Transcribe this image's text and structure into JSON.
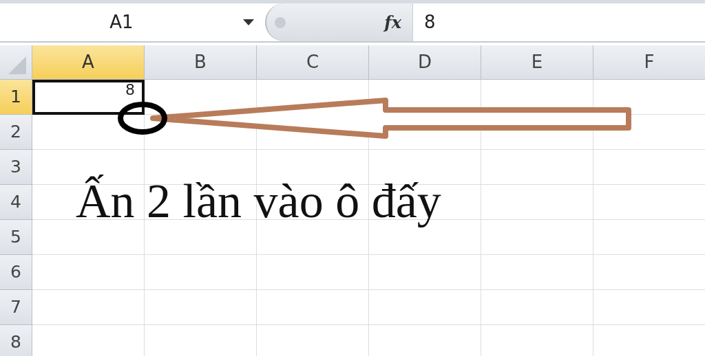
{
  "name_box": {
    "value": "A1"
  },
  "formula_bar": {
    "function_label": "fx",
    "value": "8"
  },
  "columns": [
    {
      "label": "A",
      "selected": true
    },
    {
      "label": "B",
      "selected": false
    },
    {
      "label": "C",
      "selected": false
    },
    {
      "label": "D",
      "selected": false
    },
    {
      "label": "E",
      "selected": false
    },
    {
      "label": "F",
      "selected": false
    }
  ],
  "rows": [
    {
      "label": "1",
      "selected": true,
      "cells": [
        {
          "value": "8",
          "selected": true
        }
      ]
    },
    {
      "label": "2",
      "selected": false
    },
    {
      "label": "3",
      "selected": false
    },
    {
      "label": "4",
      "selected": false
    },
    {
      "label": "5",
      "selected": false
    },
    {
      "label": "6",
      "selected": false
    },
    {
      "label": "7",
      "selected": false
    },
    {
      "label": "8",
      "selected": false
    }
  ],
  "annotation": {
    "text": "Ấn 2 lần vào ô đấy"
  }
}
